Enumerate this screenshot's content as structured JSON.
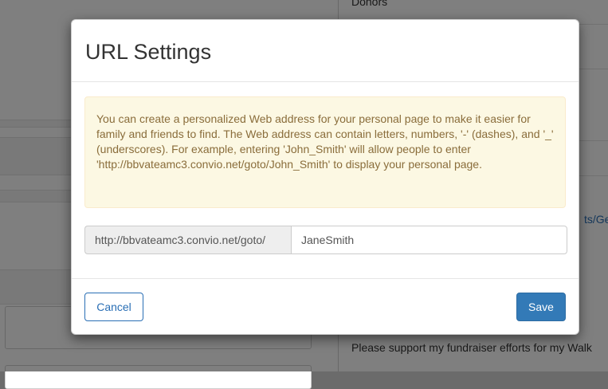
{
  "background": {
    "donors_heading": "Donors",
    "partial_link": "ts/Ge",
    "support_text": "Please support my fundraiser efforts for my Walk"
  },
  "modal": {
    "title": "URL Settings",
    "info_text": "You can create a personalized Web address for your personal page to make it easier for family and friends to find. The Web address can contain letters, numbers, '-' (dashes), and '_' (underscores). For example, entering 'John_Smith' will allow people to enter 'http://bbvateamc3.convio.net/goto/John_Smith' to display your personal page.",
    "url_prefix": "http://bbvateamc3.convio.net/goto/",
    "url_value": "JaneSmith",
    "cancel_label": "Cancel",
    "save_label": "Save"
  },
  "colors": {
    "primary": "#337ab7",
    "alert_bg": "#fcf8e3",
    "alert_text": "#8a6d3b",
    "link": "#2a6fb5"
  }
}
